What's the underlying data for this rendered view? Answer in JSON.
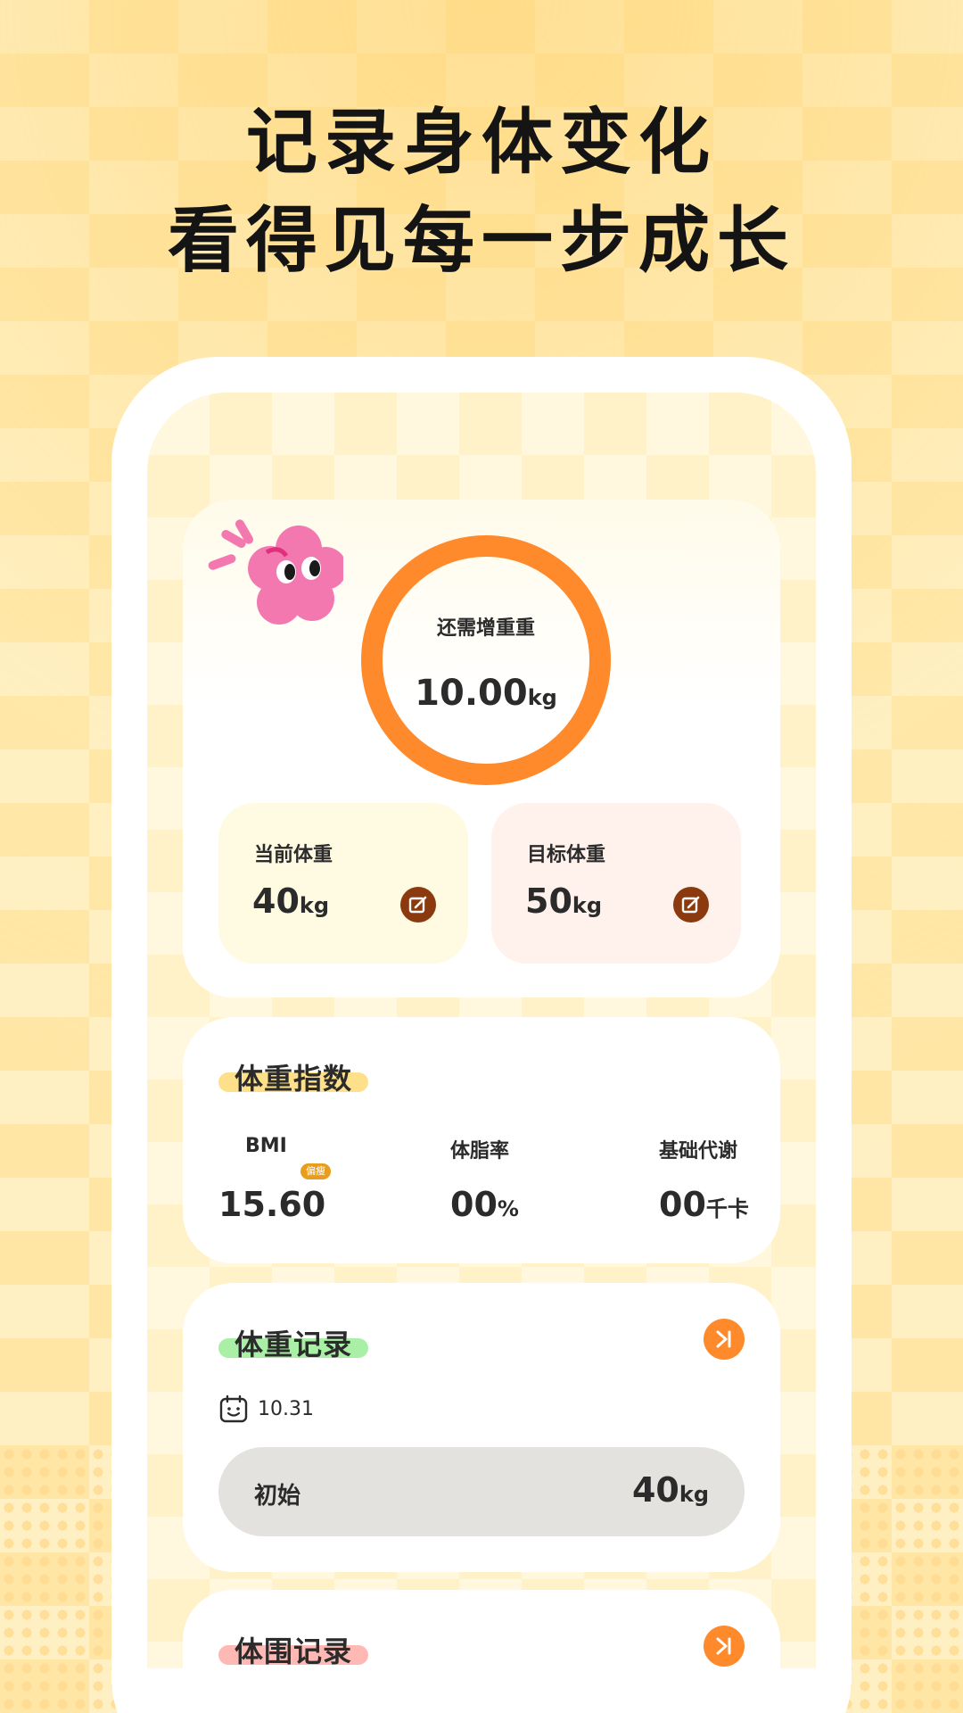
{
  "headline": {
    "line1": "记录身体变化",
    "line2": "看得见每一步成长"
  },
  "progress": {
    "label": "还需增重重",
    "value": "10.00",
    "unit": "kg",
    "ring_color": "#FF8A2B"
  },
  "weights": {
    "current": {
      "label": "当前体重",
      "value": "40",
      "unit": "kg"
    },
    "target": {
      "label": "目标体重",
      "value": "50",
      "unit": "kg"
    },
    "edit_icon": "edit-icon"
  },
  "weight_index": {
    "title": "体重指数",
    "bmi": {
      "label": "BMI",
      "value": "15.60",
      "badge": "偏瘦"
    },
    "body_fat": {
      "label": "体脂率",
      "value": "00",
      "unit": "%"
    },
    "metabolism": {
      "label": "基础代谢",
      "value": "00",
      "unit": "千卡"
    }
  },
  "weight_record": {
    "title": "体重记录",
    "date": "10.31",
    "entry_label": "初始",
    "entry_value": "40",
    "entry_unit": "kg"
  },
  "girth_record": {
    "title": "体围记录"
  },
  "colors": {
    "accent": "#FF8A2B",
    "edit_button": "#8A3A0E",
    "title_highlight_yellow": "#FFE08A",
    "title_highlight_green": "#A9EFA6",
    "title_highlight_pink": "#FFB9B4"
  }
}
